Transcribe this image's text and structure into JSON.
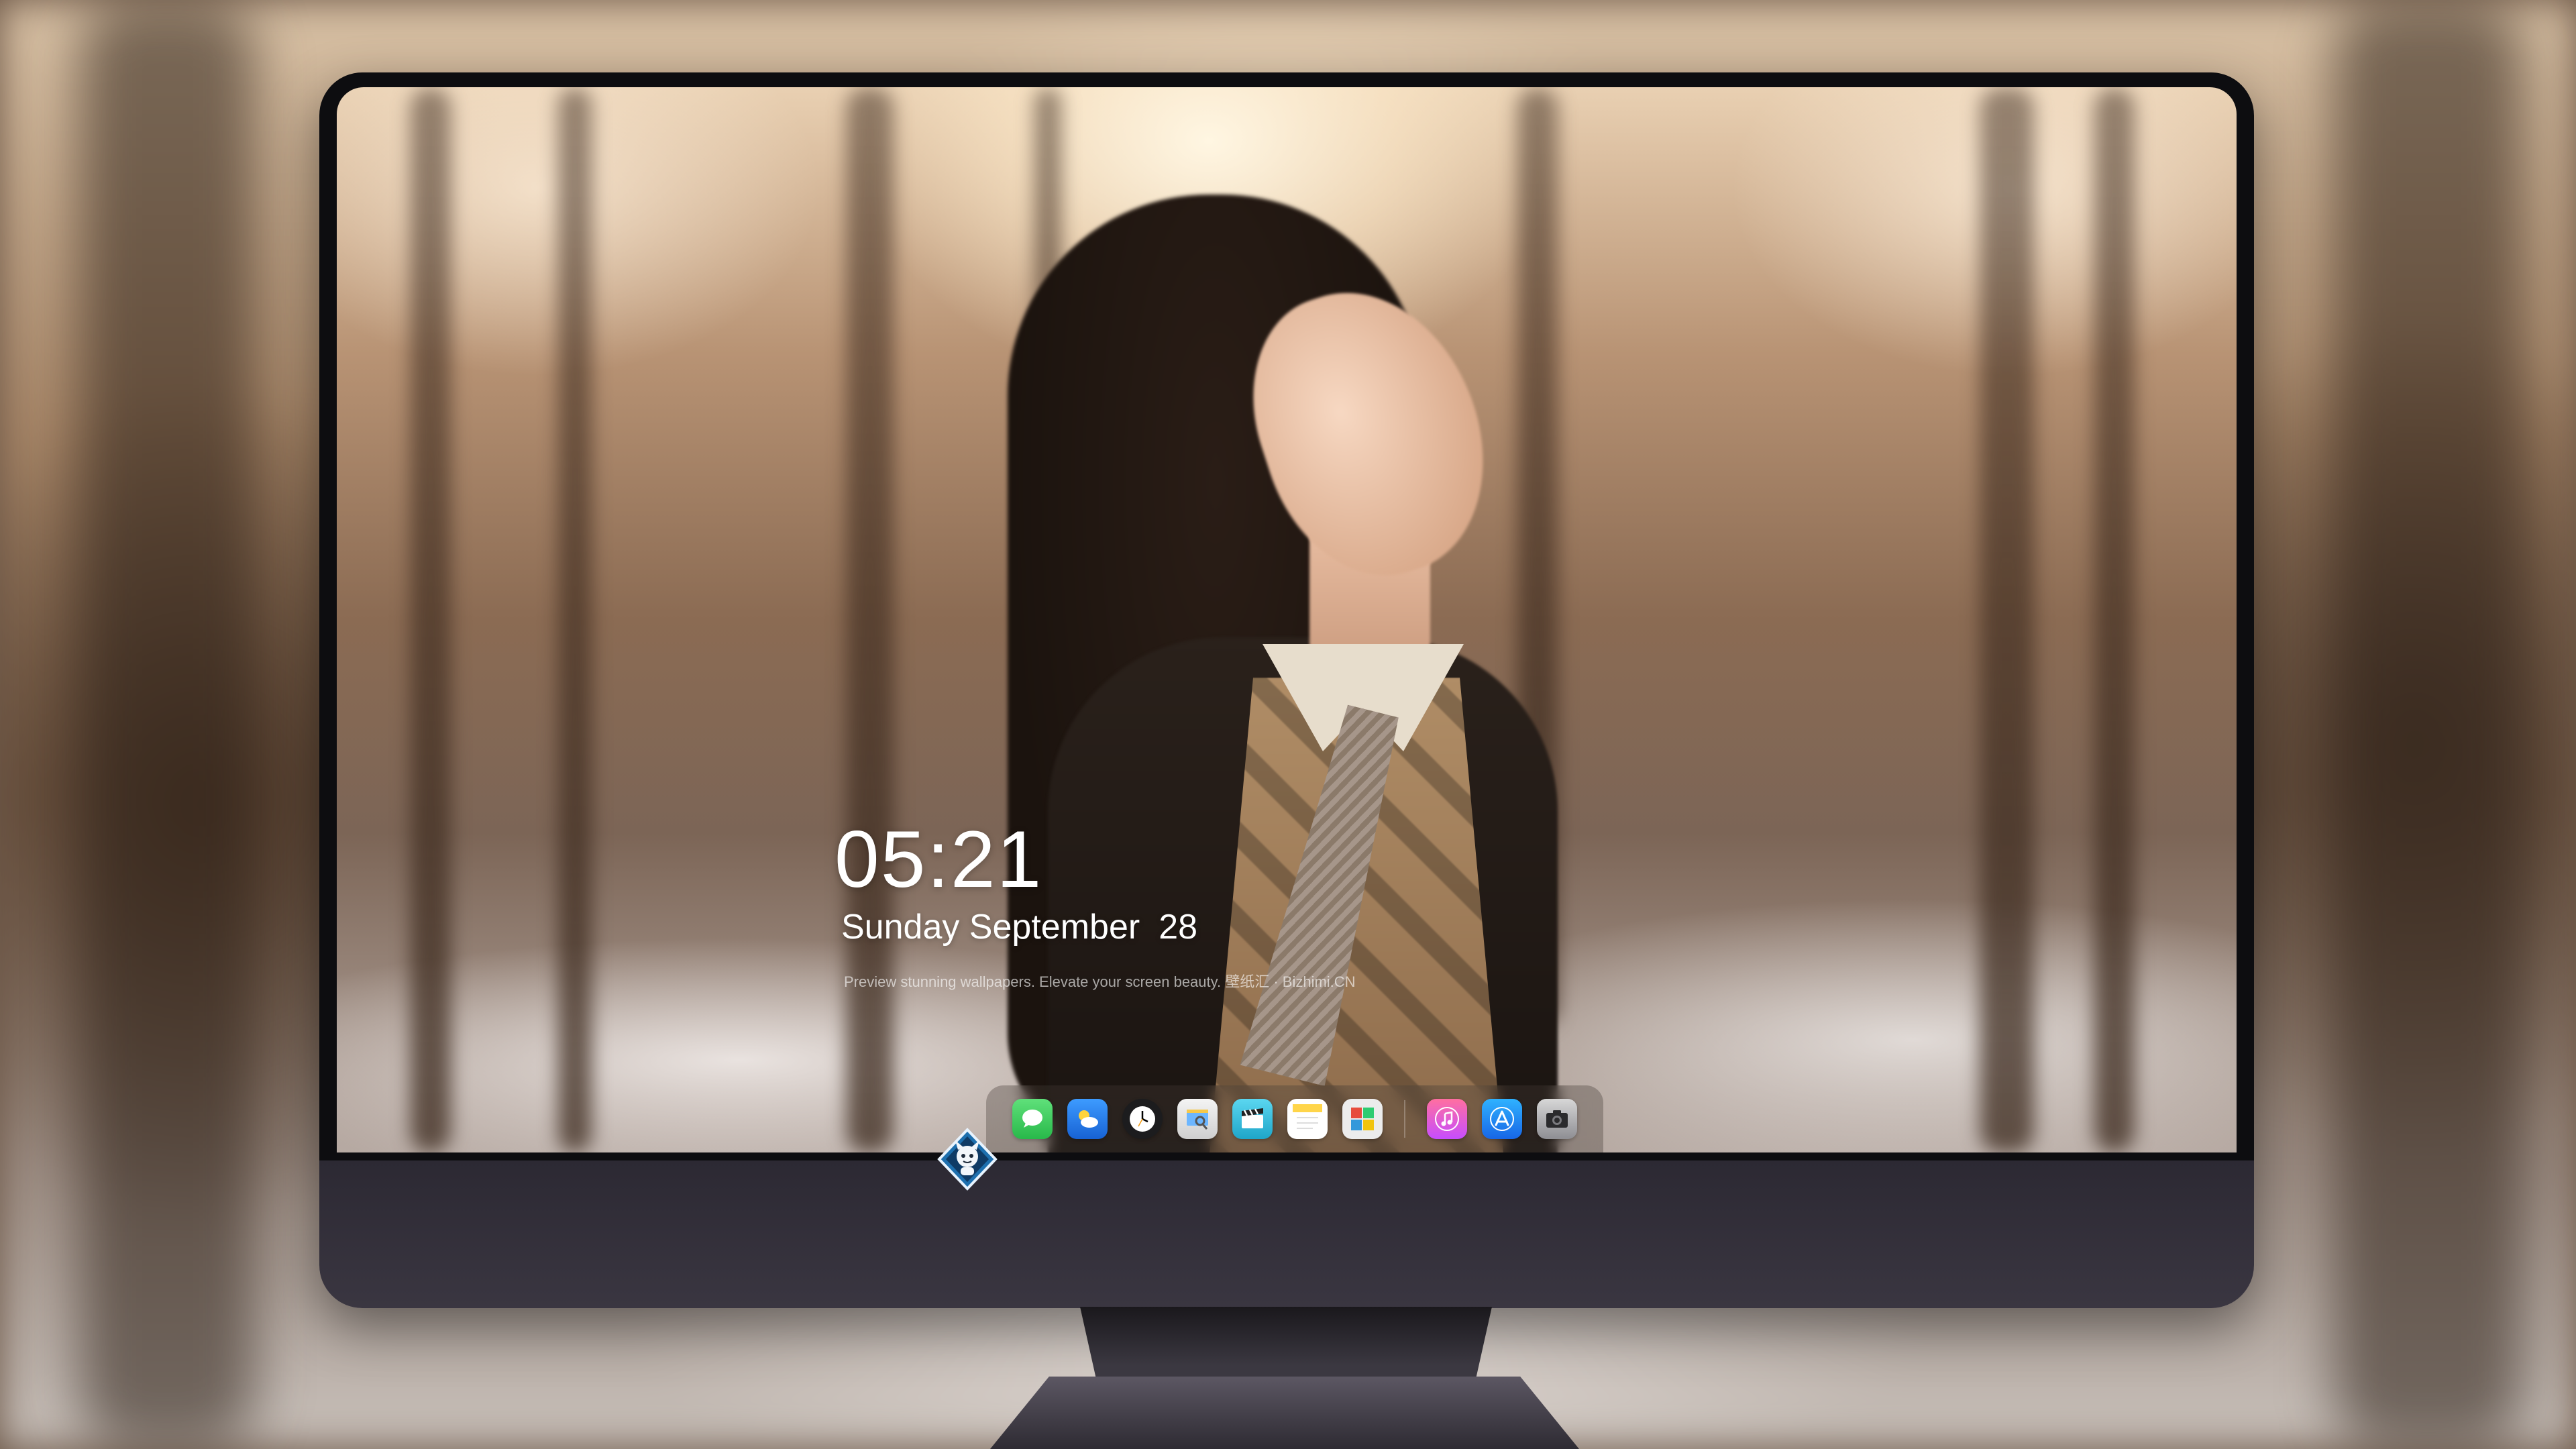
{
  "lockscreen": {
    "time": "05:21",
    "date_day": "Sunday September",
    "date_num": "28",
    "caption": "Preview stunning wallpapers. Elevate your screen beauty. 壁纸汇 · Bizhimi.CN"
  },
  "dock": {
    "apps": [
      {
        "name": "Messages",
        "icon": "messages-icon",
        "color": "#34c759"
      },
      {
        "name": "Weather",
        "icon": "weather-icon",
        "color": "#2f7ff0"
      },
      {
        "name": "Clock",
        "icon": "clock-icon",
        "color": "#ffffff"
      },
      {
        "name": "Preview",
        "icon": "preview-icon",
        "color": "#f0f0f0"
      },
      {
        "name": "Clips",
        "icon": "clips-icon",
        "color": "#40c8e0"
      },
      {
        "name": "Notes",
        "icon": "notes-icon",
        "color": "#ffd54a"
      },
      {
        "name": "Photo Booth",
        "icon": "photobooth-icon",
        "color": "#e6e6e6"
      },
      {
        "name": "Music",
        "icon": "music-icon",
        "color": "#fc5c7d"
      },
      {
        "name": "App Store",
        "icon": "appstore-icon",
        "color": "#1e8cf0"
      },
      {
        "name": "Camera",
        "icon": "camera-icon",
        "color": "#3a3a3c"
      }
    ]
  },
  "chin": {
    "logo": "mascot-logo-icon"
  }
}
